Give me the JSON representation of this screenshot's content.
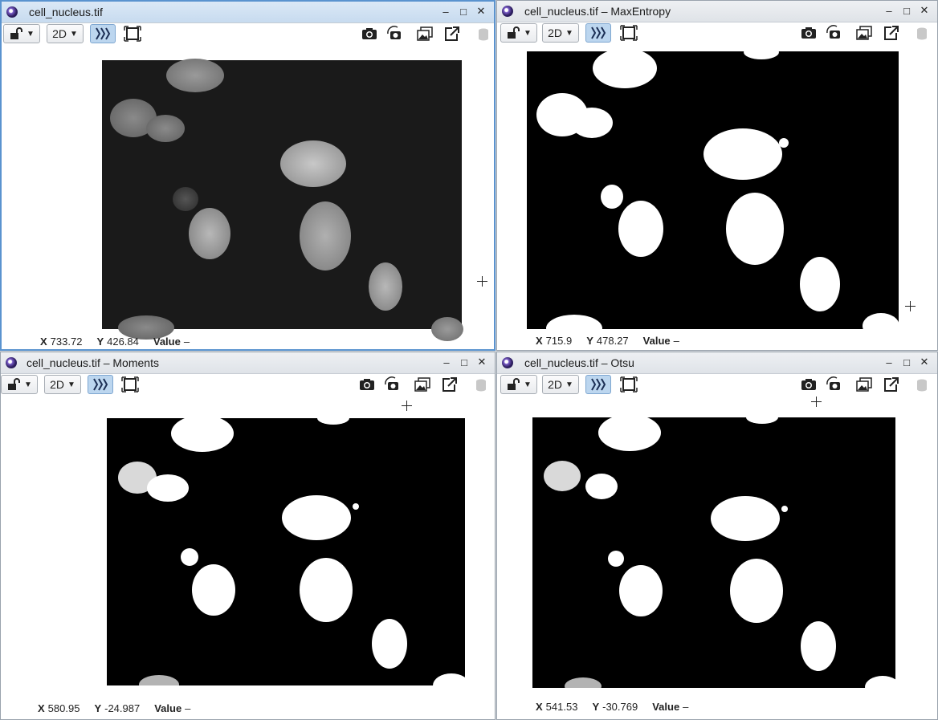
{
  "windows": [
    {
      "id": "w1",
      "title": "cell_nucleus.tif",
      "mode": "2D",
      "coords": {
        "x_label": "X",
        "x": "733.72",
        "y_label": "Y",
        "y": "426.84",
        "value_label": "Value",
        "value": "–"
      }
    },
    {
      "id": "w2",
      "title": "cell_nucleus.tif – MaxEntropy",
      "mode": "2D",
      "coords": {
        "x_label": "X",
        "x": "715.9",
        "y_label": "Y",
        "y": "478.27",
        "value_label": "Value",
        "value": "–"
      }
    },
    {
      "id": "w3",
      "title": "cell_nucleus.tif – Moments",
      "mode": "2D",
      "coords": {
        "x_label": "X",
        "x": "580.95",
        "y_label": "Y",
        "y": "-24.987",
        "value_label": "Value",
        "value": "–"
      }
    },
    {
      "id": "w4",
      "title": "cell_nucleus.tif – Otsu",
      "mode": "2D",
      "coords": {
        "x_label": "X",
        "x": "541.53",
        "y_label": "Y",
        "y": "-30.769",
        "value_label": "Value",
        "value": "–"
      }
    }
  ],
  "icons": [
    "app-icon",
    "lock-icon",
    "chevron-down-icon",
    "channels-icon",
    "fit-frame-icon",
    "camera-icon",
    "rotate-camera-icon",
    "gallery-icon",
    "open-external-icon",
    "database-icon",
    "minimize-icon",
    "maximize-icon",
    "close-icon"
  ],
  "colors": {
    "active_border": "#5a93cf",
    "toggle_bg": "#bcd6ef"
  }
}
